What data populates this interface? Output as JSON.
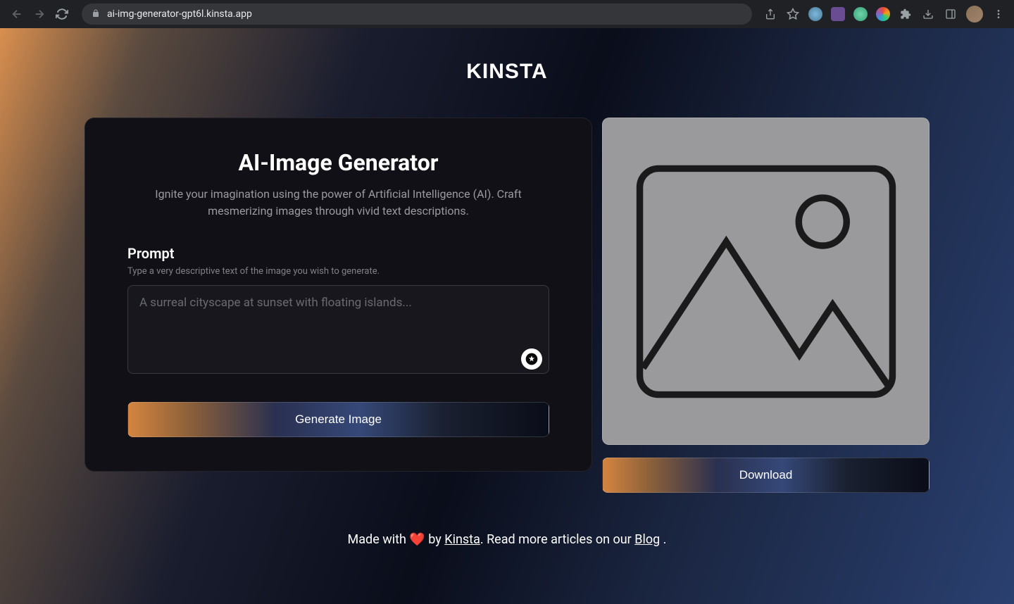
{
  "browser": {
    "url": "ai-img-generator-gpt6l.kinsta.app"
  },
  "logo": "KINSTA",
  "card": {
    "title": "AI-Image Generator",
    "subtitle": "Ignite your imagination using the power of Artificial Intelligence (AI). Craft mesmerizing images through vivid text descriptions.",
    "prompt_label": "Prompt",
    "prompt_hint": "Type a very descriptive text of the image you wish to generate.",
    "prompt_placeholder": "A surreal cityscape at sunset with floating islands...",
    "generate_label": "Generate Image"
  },
  "preview": {
    "download_label": "Download"
  },
  "footer": {
    "prefix": "Made with ",
    "heart": "❤️",
    "by": " by ",
    "link1": "Kinsta",
    "middle": ". Read more articles on our ",
    "link2": "Blog",
    "suffix": " ."
  }
}
